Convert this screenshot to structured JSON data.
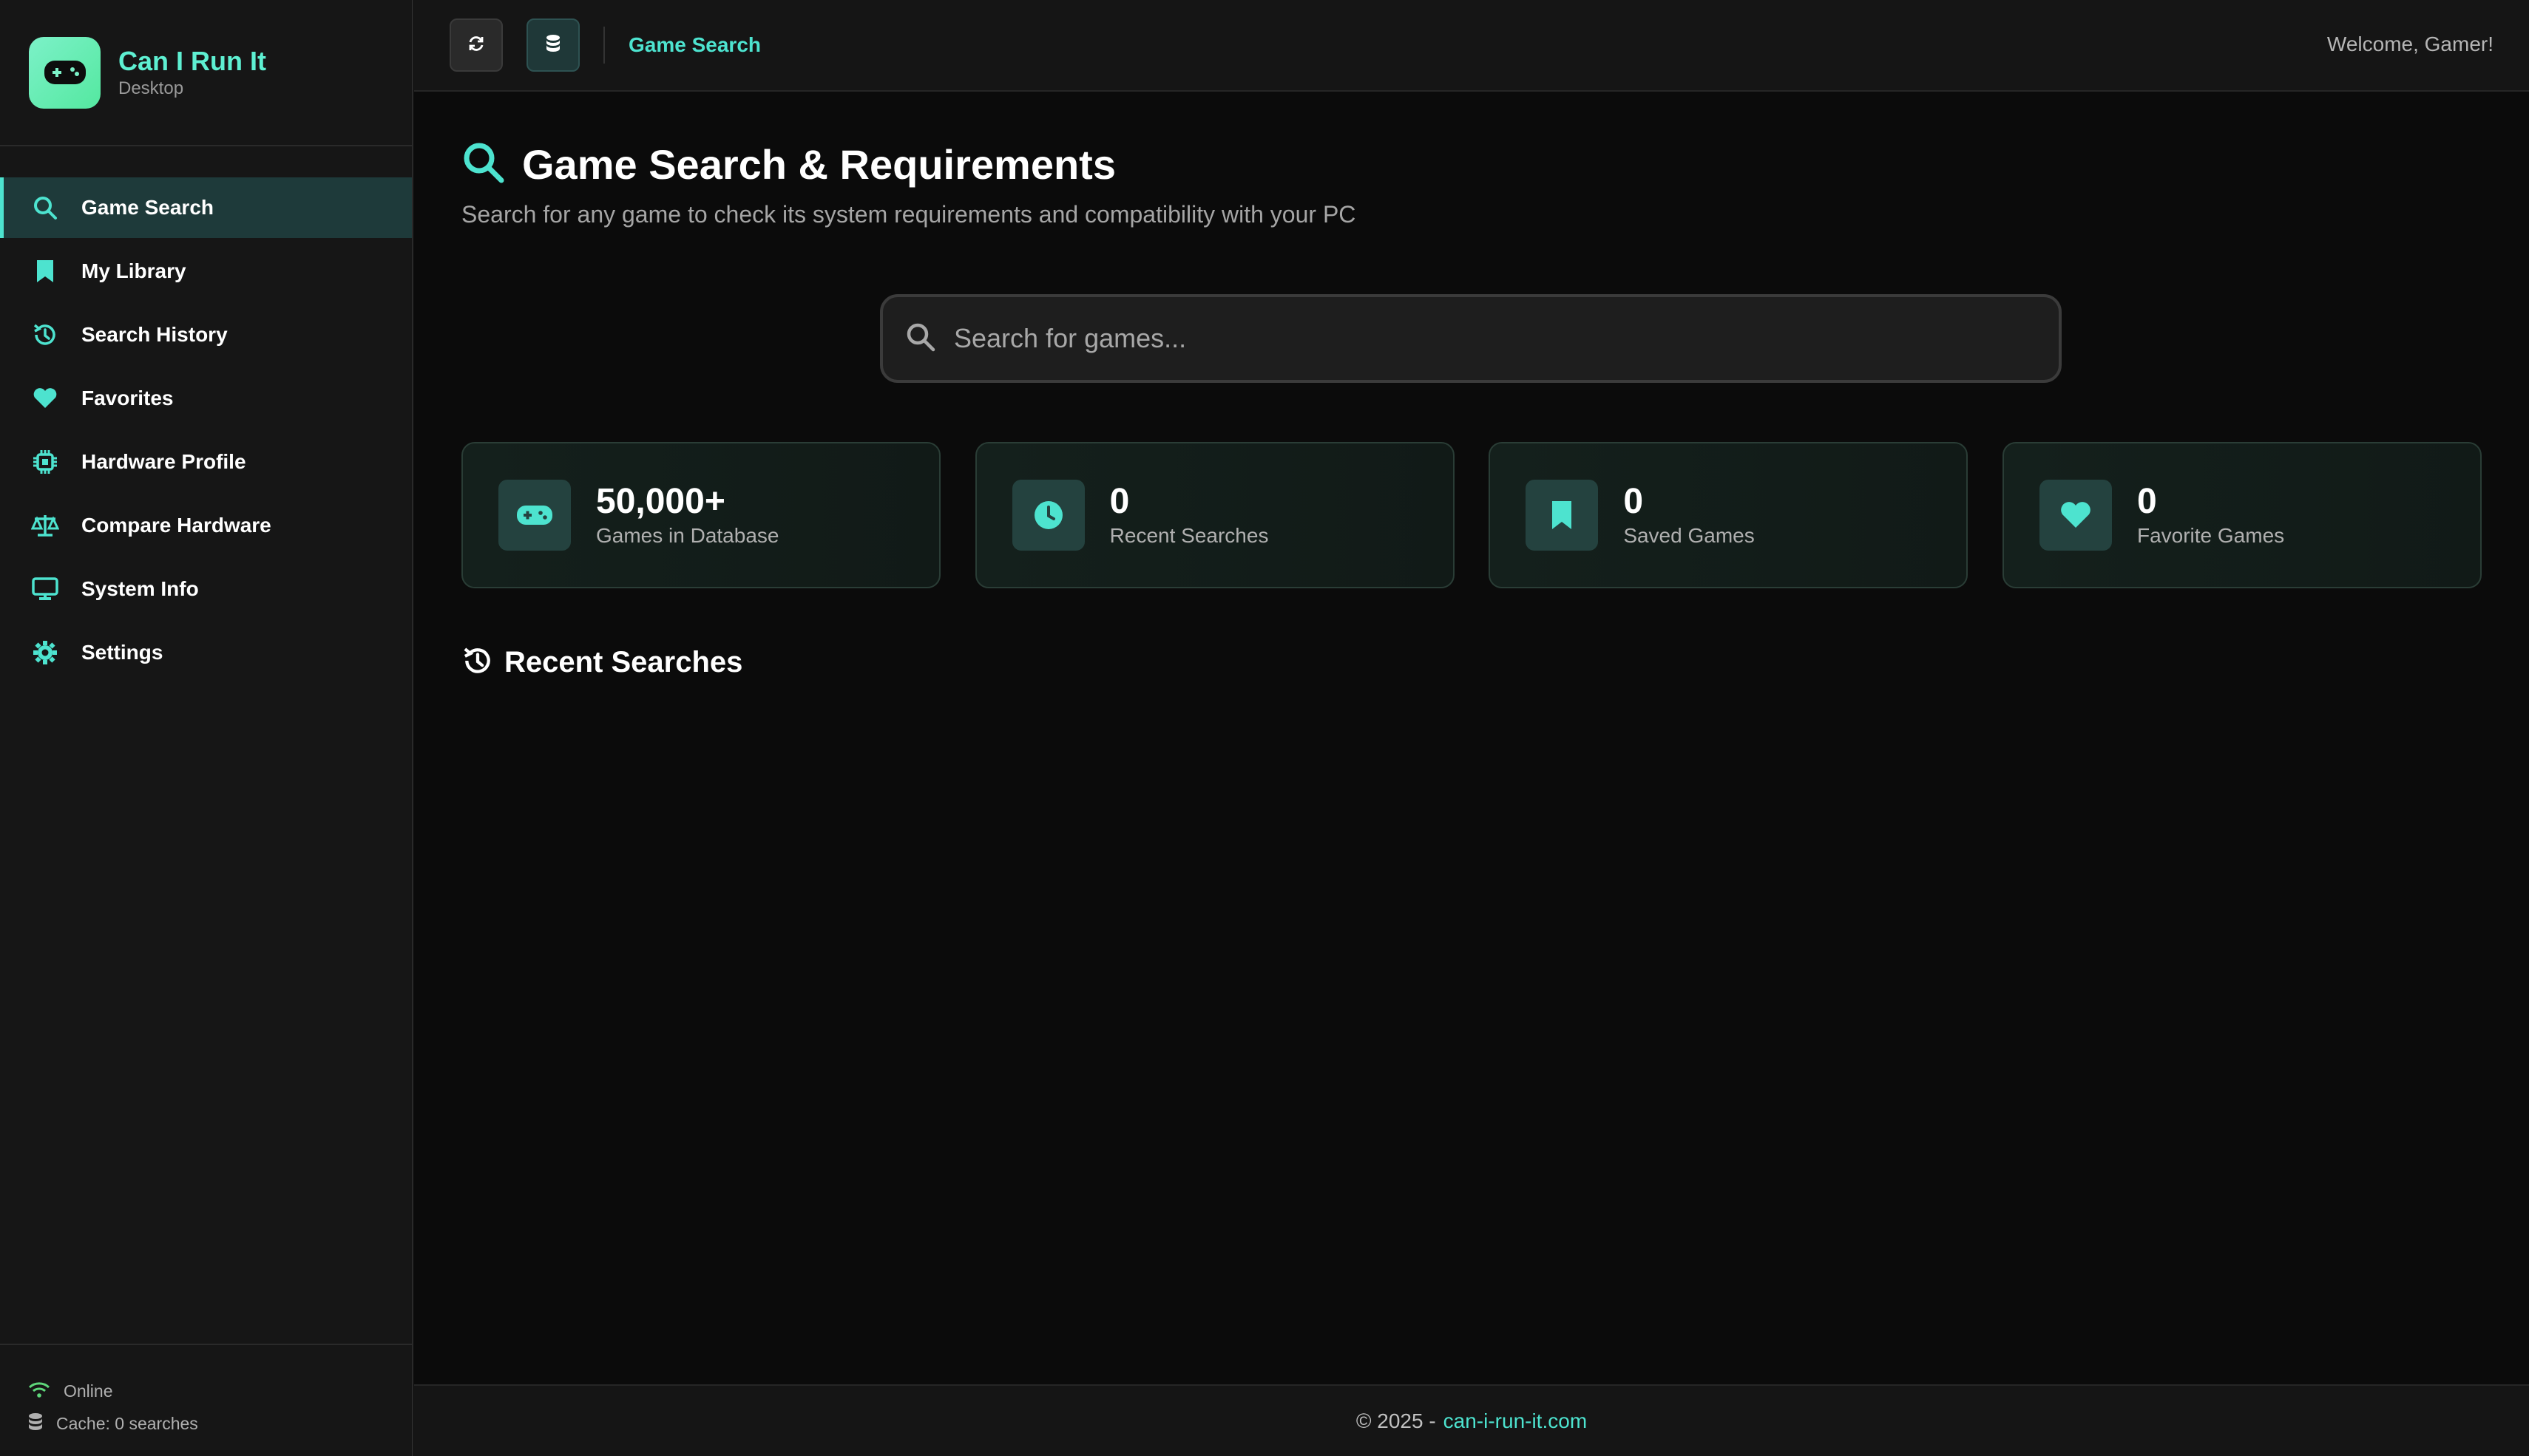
{
  "app": {
    "title": "Can I Run It",
    "subtitle": "Desktop"
  },
  "sidebar": {
    "items": [
      {
        "label": "Game Search",
        "icon": "search-icon",
        "active": true
      },
      {
        "label": "My Library",
        "icon": "bookmark-icon"
      },
      {
        "label": "Search History",
        "icon": "history-icon"
      },
      {
        "label": "Favorites",
        "icon": "heart-icon"
      },
      {
        "label": "Hardware Profile",
        "icon": "chip-icon"
      },
      {
        "label": "Compare Hardware",
        "icon": "scale-icon"
      },
      {
        "label": "System Info",
        "icon": "monitor-icon"
      },
      {
        "label": "Settings",
        "icon": "gear-icon"
      }
    ],
    "status": {
      "online": "Online",
      "cache": "Cache: 0 searches"
    }
  },
  "topbar": {
    "breadcrumb": "Game Search",
    "welcome": "Welcome, Gamer!"
  },
  "page": {
    "title": "Game Search & Requirements",
    "subtitle": "Search for any game to check its system requirements and compatibility with your PC"
  },
  "search": {
    "placeholder": "Search for games...",
    "value": ""
  },
  "stats": [
    {
      "value": "50,000+",
      "label": "Games in Database",
      "icon": "gamepad-icon"
    },
    {
      "value": "0",
      "label": "Recent Searches",
      "icon": "clock-icon"
    },
    {
      "value": "0",
      "label": "Saved Games",
      "icon": "bookmark-icon"
    },
    {
      "value": "0",
      "label": "Favorite Games",
      "icon": "heart-icon"
    }
  ],
  "recent": {
    "title": "Recent Searches"
  },
  "footer": {
    "copyright": "© 2025 -",
    "link": "can-i-run-it.com"
  },
  "colors": {
    "accent": "#4de3cf",
    "brand_gradient_start": "#7cf1c8",
    "brand_gradient_end": "#54e8a0"
  }
}
